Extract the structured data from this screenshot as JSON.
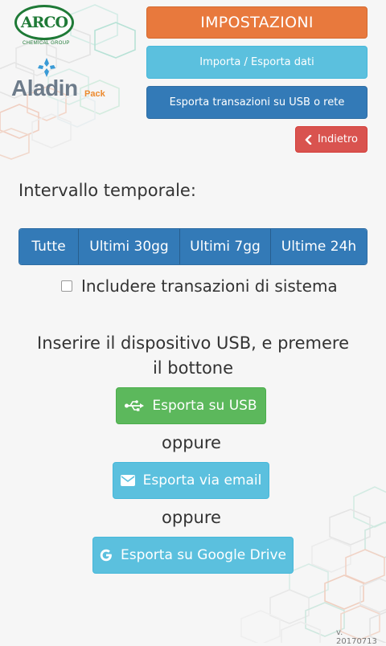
{
  "logos": {
    "arco_text": "ARCO",
    "arco_subtitle": "CHEMICAL GROUP",
    "aladin_text": "Aladin",
    "aladin_pack": "Pack"
  },
  "header": {
    "settings_label": "IMPOSTAZIONI",
    "import_export_label": "Importa / Esporta dati",
    "export_transactions_label": "Esporta transazioni su USB o rete",
    "back_label": "Indietro"
  },
  "interval": {
    "title": "Intervallo temporale:",
    "options": [
      "Tutte",
      "Ultimi 30gg",
      "Ultimi 7gg",
      "Ultime 24h"
    ]
  },
  "system_transactions": {
    "label": "Includere transazioni di sistema",
    "checked": false
  },
  "export": {
    "instructions": "Inserire il dispositivo USB, e premere il bottone",
    "usb_label": "Esporta su USB",
    "or_1": "oppure",
    "email_label": "Esporta via email",
    "or_2": "oppure",
    "gdrive_label": "Esporta su Google Drive"
  },
  "version": "v. 20170713",
  "colors": {
    "orange": "#e8793d",
    "info": "#5bc0de",
    "primary": "#337ab7",
    "danger": "#d9534f",
    "success": "#5cb85c"
  },
  "icons": [
    "chevron-left-icon",
    "usb-icon",
    "envelope-icon",
    "google-icon",
    "checkbox-icon"
  ]
}
